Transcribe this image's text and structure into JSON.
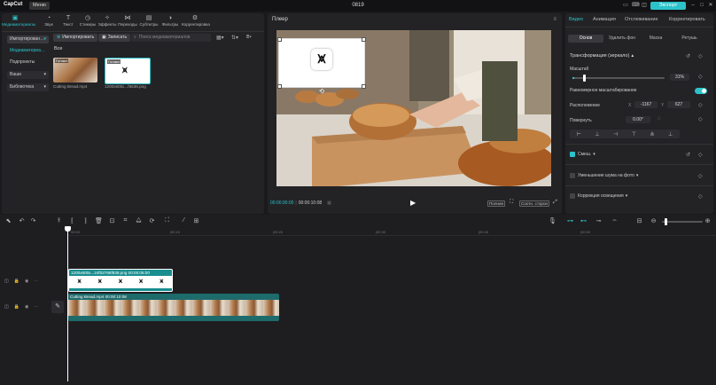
{
  "app": {
    "logo": "CapCut",
    "menu": "Меню",
    "project_title": "0819",
    "export": "Экспорт"
  },
  "media": {
    "tool_tabs": [
      {
        "label": "Медиаматериалы",
        "icon": "media-icon"
      },
      {
        "label": "Звук",
        "icon": "audio-icon"
      },
      {
        "label": "Текст",
        "icon": "text-icon"
      },
      {
        "label": "Стикеры",
        "icon": "sticker-icon"
      },
      {
        "label": "Эффекты",
        "icon": "effects-icon"
      },
      {
        "label": "Переходы",
        "icon": "transitions-icon"
      },
      {
        "label": "Субтитры",
        "icon": "subtitles-icon"
      },
      {
        "label": "Фильтры",
        "icon": "filters-icon"
      },
      {
        "label": "Корректировка",
        "icon": "adjust-icon"
      }
    ],
    "sidebar": [
      "Импортирован…",
      "Медиаматериа…",
      "Подпроекты",
      "Ваши",
      "Библиотека"
    ],
    "import_btn": "Импортировать",
    "record_btn": "Записать",
    "search_placeholder": "Поиск медиаматериалов",
    "all_label": "Все",
    "items": [
      {
        "name": "Cutting Bread.mp4",
        "badge": "Готово!",
        "duration": ""
      },
      {
        "name": "1200x600x...f6638.png",
        "badge": "Готово!",
        "duration": ""
      }
    ]
  },
  "player": {
    "title": "Плеер",
    "time_current": "00:00:00:00",
    "time_total": "00:00:10:08",
    "quality": "Полная",
    "ratio": "Соотн. сторон"
  },
  "inspector": {
    "tabs": [
      "Видео",
      "Анимация",
      "Отслеживание",
      "Корректировать"
    ],
    "subtabs": [
      "Основ",
      "Удалить фон",
      "Маска",
      "Ретушь"
    ],
    "transform_label": "Трансформация (зеркало)",
    "scale_label": "Масштаб",
    "scale_value": "31%",
    "scale_fraction": 0.31,
    "uniform_label": "Равномерное масштабирование",
    "position_label": "Расположение",
    "pos_x": "-1167",
    "pos_y": "627",
    "rotate_label": "Повернуть",
    "rotate_value": "0.00°",
    "blend_label": "Смеш.",
    "denoise_label": "Уменьшение шума на фото",
    "light_label": "Коррекция освещения"
  },
  "timeline": {
    "ruler": [
      "00:00",
      "|00:10",
      "|00:20",
      "|00:30",
      "|00:40",
      "|00:50"
    ],
    "clips": [
      {
        "name": "1200x600x...24f02766f638.png",
        "duration": "00:00:05:00"
      },
      {
        "name": "Cutting Bread.mp4",
        "duration": "00:00:10:08"
      }
    ]
  },
  "colors": {
    "accent": "#2bc3c9",
    "clip_png": "#1a8d8f",
    "clip_video": "#1e6b6c"
  }
}
